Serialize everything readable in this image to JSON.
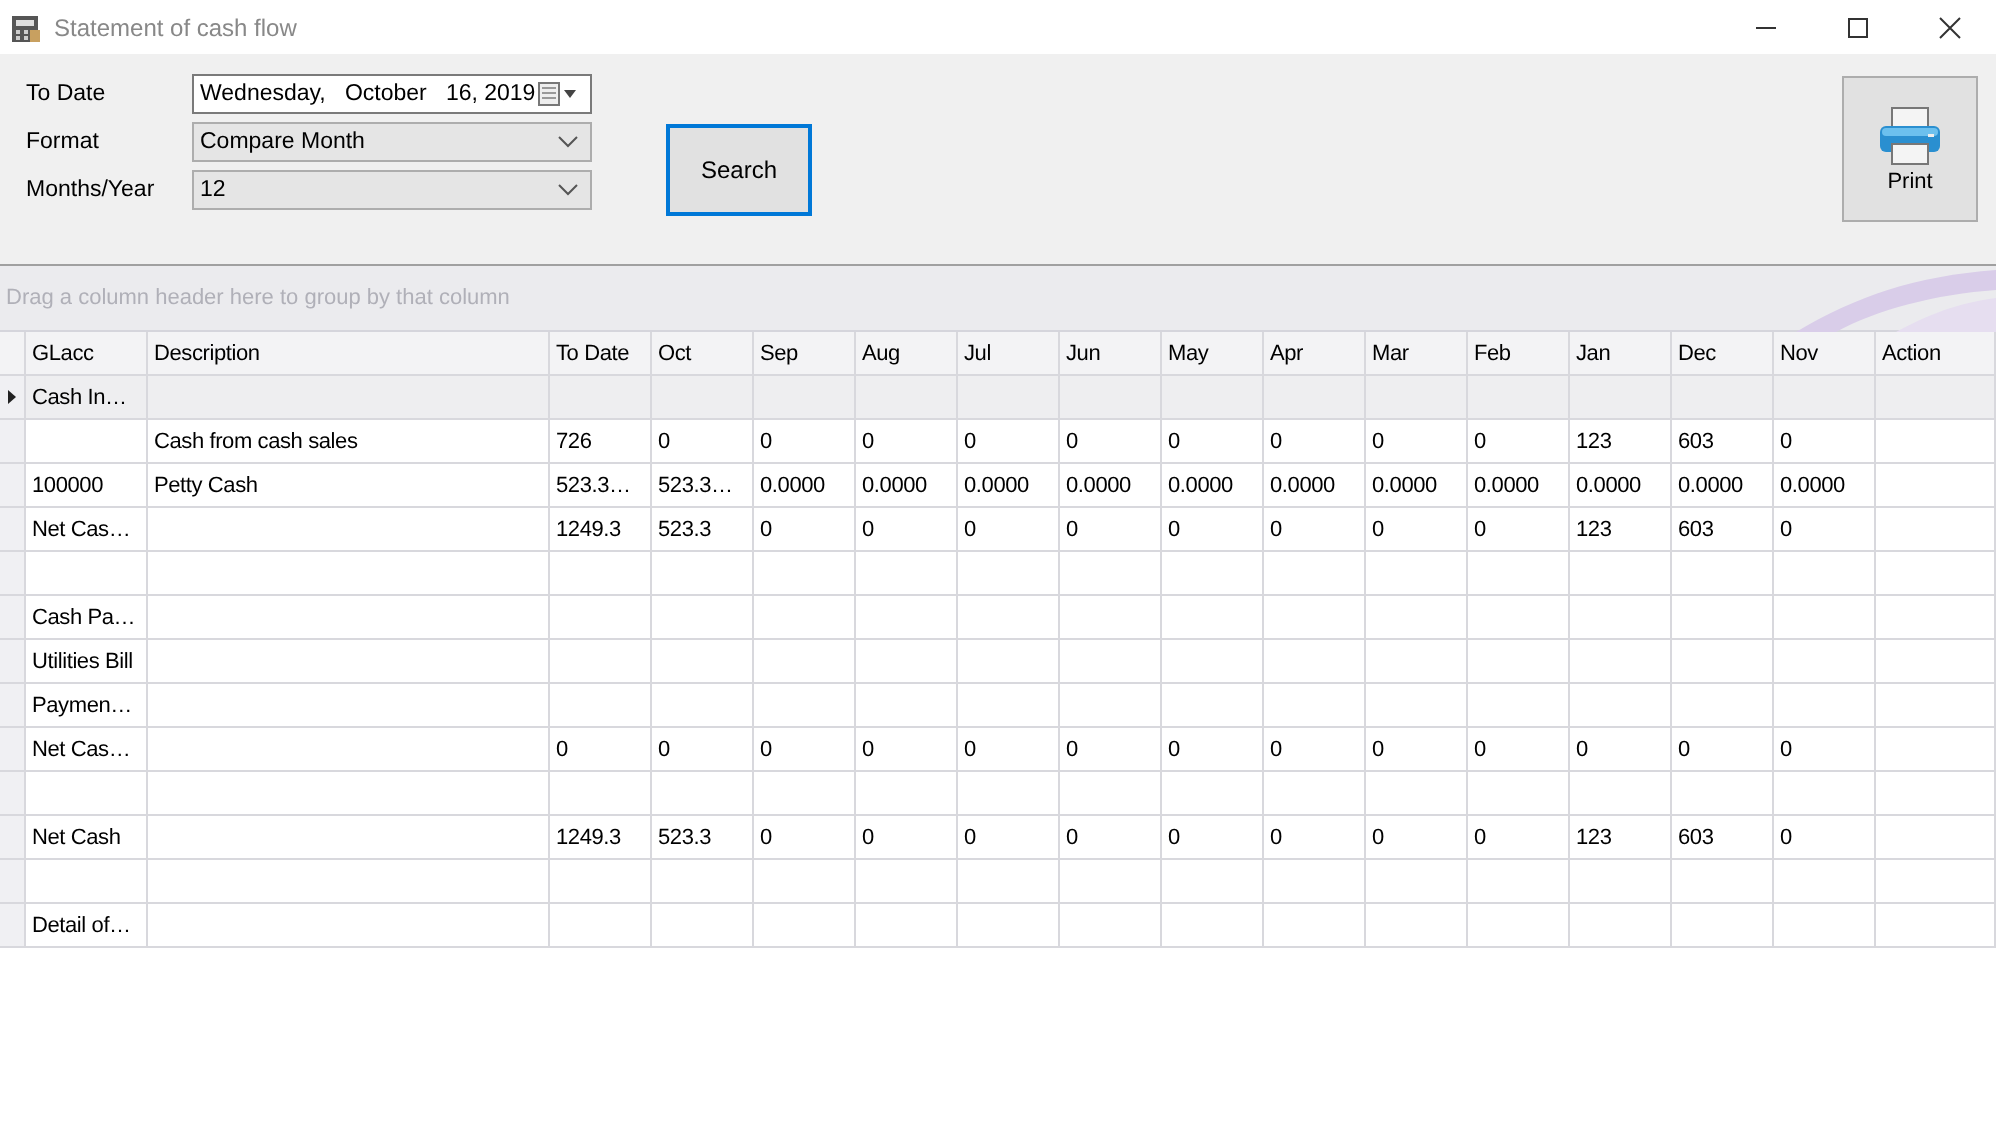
{
  "window": {
    "title": "Statement of cash flow"
  },
  "filters": [
    {
      "kind": "date",
      "label": "To Date",
      "value": "Wednesday,   October   16, 2019"
    },
    {
      "kind": "combo",
      "label": "Format",
      "value": "Compare Month"
    },
    {
      "kind": "combo",
      "label": "Months/Year",
      "value": "12"
    }
  ],
  "search_button": "Search",
  "print_button": "Print",
  "group_panel": {
    "prompt": "Drag a column header here to group by that column"
  },
  "table": {
    "columns": [
      "GLacc",
      "Description",
      "To Date",
      "Oct",
      "Sep",
      "Aug",
      "Jul",
      "Jun",
      "May",
      "Apr",
      "Mar",
      "Feb",
      "Jan",
      "Dec",
      "Nov",
      "Action"
    ],
    "rows": [
      {
        "selected": true,
        "glacc": "Cash In…"
      },
      {
        "selected": false,
        "description": "Cash from cash sales",
        "values": [
          "726",
          "0",
          "0",
          "0",
          "0",
          "0",
          "0",
          "0",
          "0",
          "0",
          "123",
          "603",
          "0"
        ]
      },
      {
        "selected": false,
        "glacc": "100000",
        "description": "Petty Cash",
        "values": [
          "523.3…",
          "523.3…",
          "0.0000",
          "0.0000",
          "0.0000",
          "0.0000",
          "0.0000",
          "0.0000",
          "0.0000",
          "0.0000",
          "0.0000",
          "0.0000",
          "0.0000"
        ]
      },
      {
        "selected": false,
        "glacc": "Net Cas…",
        "values": [
          "1249.3",
          "523.3",
          "0",
          "0",
          "0",
          "0",
          "0",
          "0",
          "0",
          "0",
          "123",
          "603",
          "0"
        ]
      },
      {
        "selected": false
      },
      {
        "selected": false,
        "glacc": "Cash Pa…"
      },
      {
        "selected": false,
        "glacc": "Utilities Bill"
      },
      {
        "selected": false,
        "glacc": "Paymen…"
      },
      {
        "selected": false,
        "glacc": "Net Cas…",
        "values": [
          "0",
          "0",
          "0",
          "0",
          "0",
          "0",
          "0",
          "0",
          "0",
          "0",
          "0",
          "0",
          "0"
        ]
      },
      {
        "selected": false
      },
      {
        "selected": false,
        "glacc": "Net Cash",
        "values": [
          "1249.3",
          "523.3",
          "0",
          "0",
          "0",
          "0",
          "0",
          "0",
          "0",
          "0",
          "123",
          "603",
          "0"
        ]
      },
      {
        "selected": false
      },
      {
        "selected": false,
        "glacc": "Detail of…"
      }
    ]
  }
}
